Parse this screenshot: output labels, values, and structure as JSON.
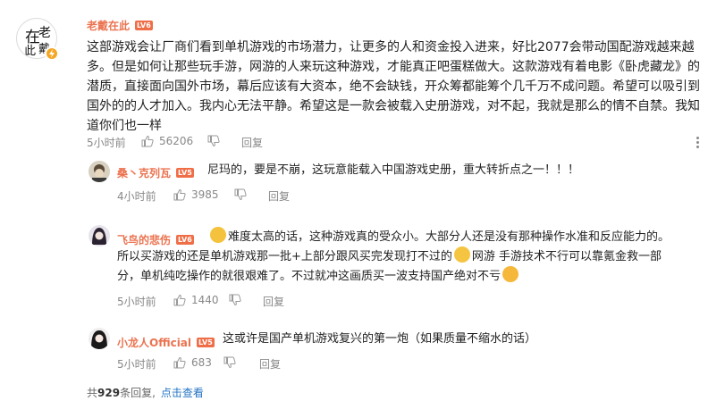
{
  "main_comment": {
    "username": "老戴在此",
    "level": "LV6",
    "text": "这部游戏会让厂商们看到单机游戏的市场潜力，让更多的人和资金投入进来，好比2077会带动国配游戏越来越多。但是如何让那些玩手游，网游的人来玩这种游戏，才能真正吧蛋糕做大。这款游戏有着电影《卧虎藏龙》的潜质，直接面向国外市场，幕后应该有大资本，绝不会缺钱，开众筹都能筹个几千万不成问题。希望可以吸引到国外的的人才加入。我内心无法平静。希望这是一款会被载入史册游戏，对不起，我就是那么的情不自禁。我知道你们也一样",
    "time": "5小时前",
    "likes": "56206",
    "reply_label": "回复"
  },
  "replies": [
    {
      "username": "桑丶克列瓦",
      "level": "LV5",
      "text": "尼玛的，要是不崩，这玩意能载入中国游戏史册，重大转折点之一！！！",
      "time": "4小时前",
      "likes": "3985",
      "reply_label": "回复"
    },
    {
      "username": "飞鸟的悲伤",
      "level": "LV6",
      "text_1": "难度太高的话，这种游戏真的受众小。大部分人还是没有那种操作水准和反应能力的。",
      "text_2": "所以买游戏的还是单机游戏那一批+上部分跟风买完发现打不过的",
      "text_3": "网游 手游技术不行可以靠氪金救一部",
      "text_4": "分，单机纯吃操作的就很艰难了。不过就冲这画质买一波支持国产绝对不亏",
      "time": "5小时前",
      "likes": "1440",
      "reply_label": "回复"
    },
    {
      "username": "小龙人Official",
      "level": "LV5",
      "text": "这或许是国产单机游戏复兴的第一炮（如果质量不缩水的话）",
      "time": "5小时前",
      "likes": "683",
      "reply_label": "回复"
    }
  ],
  "footer": {
    "total_prefix": "共",
    "total_count": "929",
    "total_suffix": "条回复,",
    "view_link": "点击查看"
  },
  "icons": {
    "like": "thumbs-up-icon",
    "dislike": "thumbs-down-icon",
    "more": "more-vertical-icon",
    "verified": "lightning-badge-icon"
  },
  "colors": {
    "username": "#eb7350",
    "level_badge": "#f06e47",
    "meta": "#888888",
    "link": "#2574c4"
  }
}
